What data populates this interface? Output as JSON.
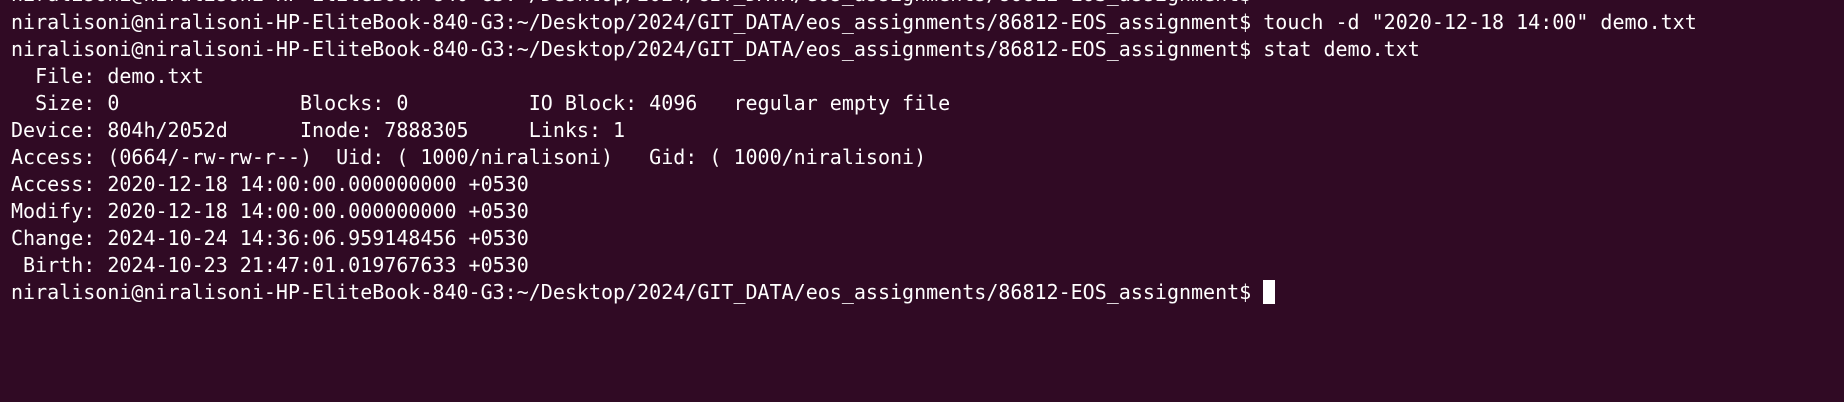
{
  "terminal": {
    "background": "#300a24",
    "foreground": "#ffffff",
    "partial_top_line": "niralisoni@niralisoni-HP-EliteBook-840-G3:~/Desktop/2024/GIT_DATA/eos_assignments/86812-EOS_assignment$",
    "lines": [
      "niralisoni@niralisoni-HP-EliteBook-840-G3:~/Desktop/2024/GIT_DATA/eos_assignments/86812-EOS_assignment$ touch -d \"2020-12-18 14:00\" demo.txt",
      "niralisoni@niralisoni-HP-EliteBook-840-G3:~/Desktop/2024/GIT_DATA/eos_assignments/86812-EOS_assignment$ stat demo.txt",
      "  File: demo.txt",
      "  Size: 0               Blocks: 0          IO Block: 4096   regular empty file",
      "Device: 804h/2052d      Inode: 7888305     Links: 1",
      "Access: (0664/-rw-rw-r--)  Uid: ( 1000/niralisoni)   Gid: ( 1000/niralisoni)",
      "Access: 2020-12-18 14:00:00.000000000 +0530",
      "Modify: 2020-12-18 14:00:00.000000000 +0530",
      "Change: 2024-10-24 14:36:06.959148456 +0530",
      " Birth: 2024-10-23 21:47:01.019767633 +0530"
    ],
    "prompt": "niralisoni@niralisoni-HP-EliteBook-840-G3:~/Desktop/2024/GIT_DATA/eos_assignments/86812-EOS_assignment$ "
  }
}
